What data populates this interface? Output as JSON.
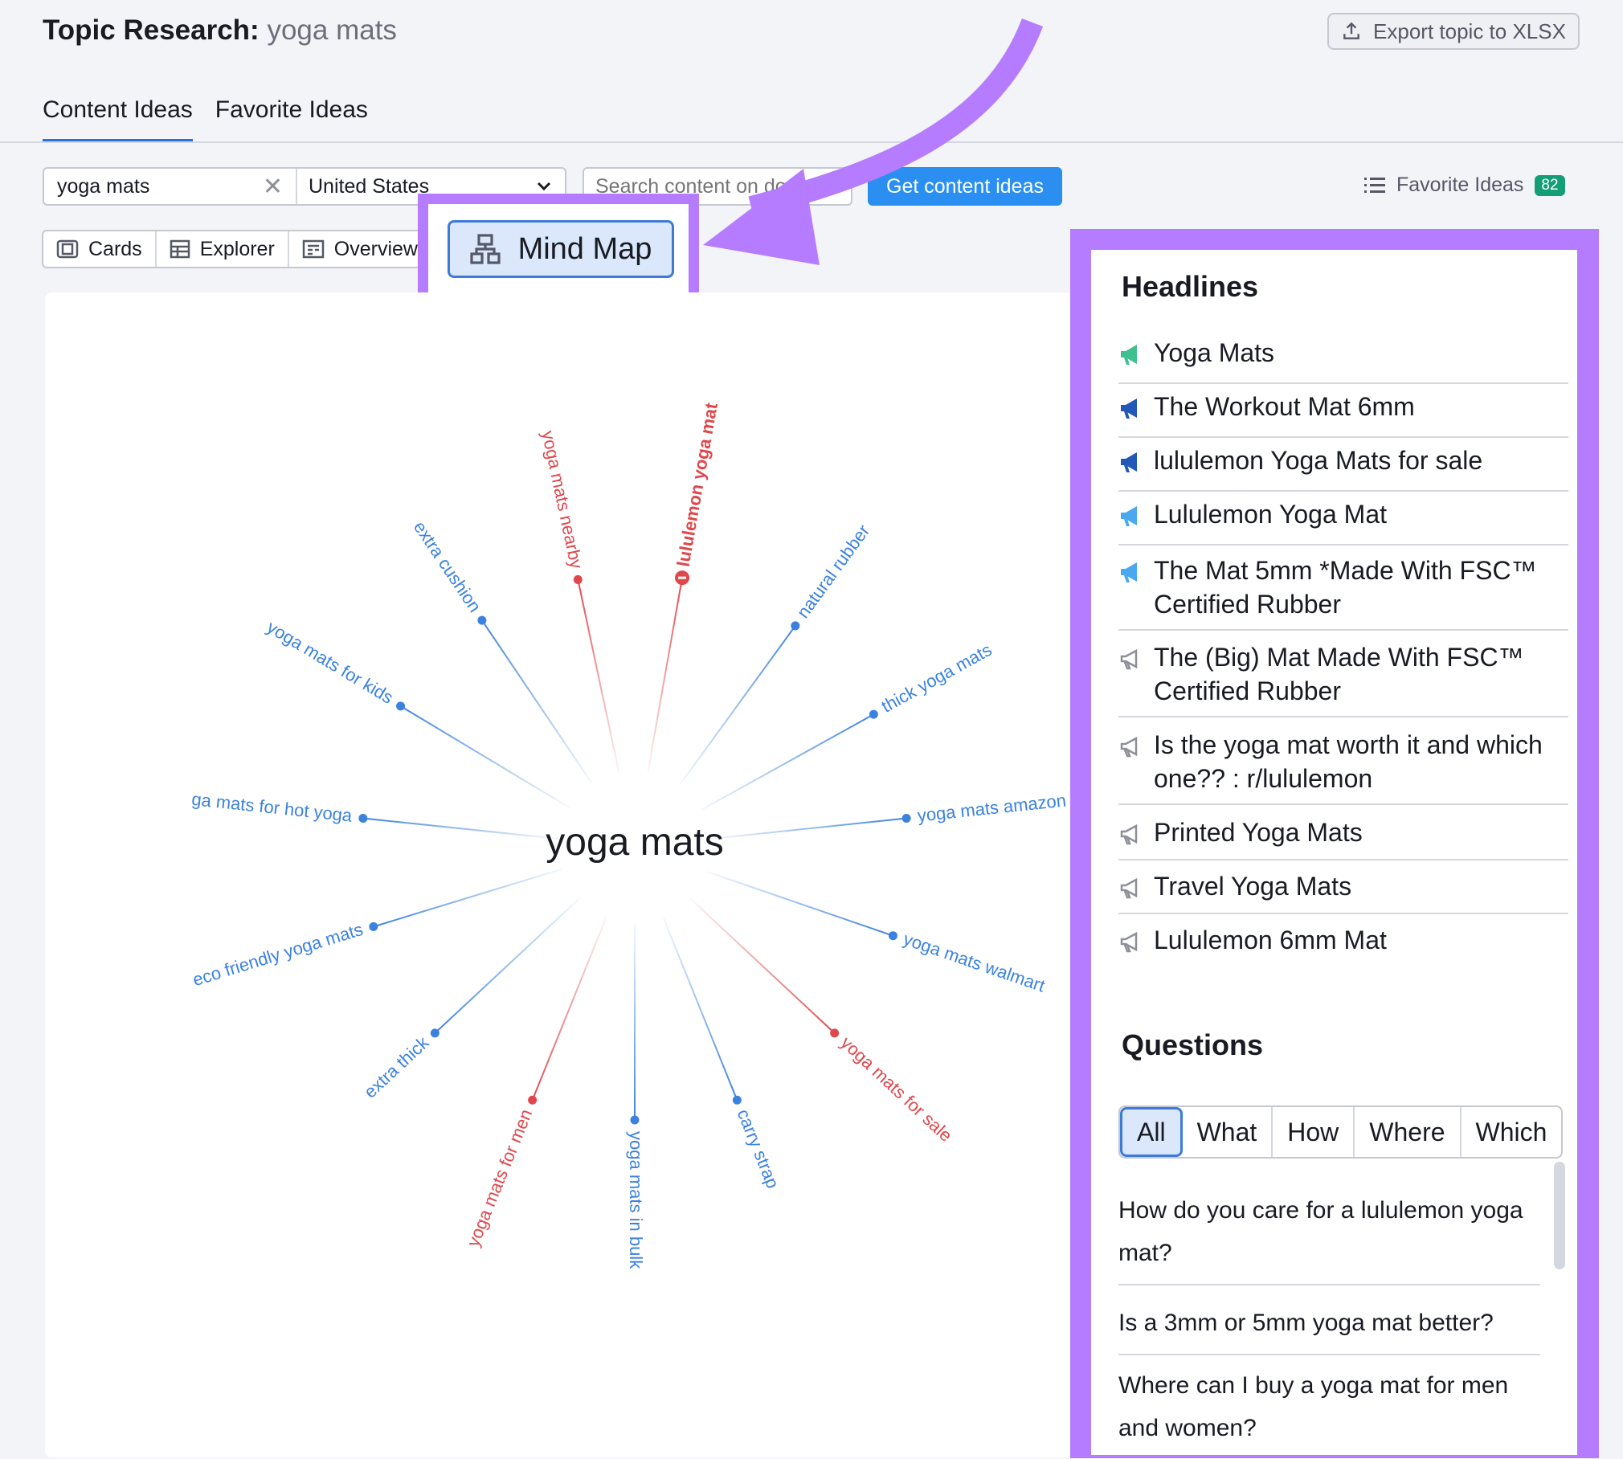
{
  "header": {
    "title_label": "Topic Research:",
    "keyword": "yoga mats",
    "export_label": "Export topic to XLSX"
  },
  "tabs": [
    {
      "label": "Content Ideas",
      "active": true
    },
    {
      "label": "Favorite Ideas",
      "active": false
    }
  ],
  "search": {
    "query": "yoga mats",
    "country": "United States",
    "domain_placeholder": "Search content on domain",
    "submit_label": "Get content ideas"
  },
  "favorites": {
    "label": "Favorite Ideas",
    "count": "82"
  },
  "views": [
    {
      "label": "Cards",
      "icon": "cards-icon"
    },
    {
      "label": "Explorer",
      "icon": "table-icon"
    },
    {
      "label": "Overview",
      "icon": "overview-icon"
    },
    {
      "label": "Mind Map",
      "icon": "mindmap-icon",
      "active": true
    }
  ],
  "mindmap": {
    "center": "yoga mats",
    "nodes": [
      {
        "label": "yoga mats nearby",
        "color": "#e0474c",
        "angle": -102
      },
      {
        "label": "lululemon yoga mat",
        "color": "#e0474c",
        "angle": -80,
        "selected": true
      },
      {
        "label": "natural rubber",
        "color": "#3b82e0",
        "angle": -54
      },
      {
        "label": "thick yoga mats",
        "color": "#3b82e0",
        "angle": -29
      },
      {
        "label": "yoga mats amazon",
        "color": "#3b82e0",
        "angle": -6
      },
      {
        "label": "yoga mats walmart",
        "color": "#3b82e0",
        "angle": 19
      },
      {
        "label": "yoga mats for sale",
        "color": "#e0474c",
        "angle": 43
      },
      {
        "label": "carry strap",
        "color": "#3b82e0",
        "angle": 68
      },
      {
        "label": "yoga mats in bulk",
        "color": "#3b82e0",
        "angle": 90
      },
      {
        "label": "yoga mats for men",
        "color": "#e0474c",
        "angle": 112
      },
      {
        "label": "extra thick",
        "color": "#3b82e0",
        "angle": 137
      },
      {
        "label": "eco friendly yoga mats",
        "color": "#3b82e0",
        "angle": 163
      },
      {
        "label": "ga mats for hot yoga",
        "color": "#3b82e0",
        "angle": 186
      },
      {
        "label": "yoga mats for kids",
        "color": "#3b82e0",
        "angle": 211
      },
      {
        "label": "extra cushion",
        "color": "#3b82e0",
        "angle": 236
      }
    ]
  },
  "headlines": {
    "title": "Headlines",
    "items": [
      {
        "text": "Yoga Mats",
        "icon_color": "#3fc08f"
      },
      {
        "text": "The Workout Mat 6mm",
        "icon_color": "#2458b8"
      },
      {
        "text": "lululemon Yoga Mats for sale",
        "icon_color": "#2458b8"
      },
      {
        "text": "Lululemon Yoga Mat",
        "icon_color": "#4aa8f0"
      },
      {
        "text": "The Mat 5mm *Made With FSC™ Certified Rubber",
        "icon_color": "#4aa8f0"
      },
      {
        "text": "The (Big) Mat Made With FSC™ Certified Rubber",
        "icon_color": "#8e9099"
      },
      {
        "text": "Is the yoga mat worth it and which one?? : r/lululemon",
        "icon_color": "#8e9099"
      },
      {
        "text": "Printed Yoga Mats",
        "icon_color": "#8e9099"
      },
      {
        "text": "Travel Yoga Mats",
        "icon_color": "#8e9099"
      },
      {
        "text": "Lululemon 6mm Mat",
        "icon_color": "#8e9099"
      }
    ]
  },
  "questions": {
    "title": "Questions",
    "filters": [
      "All",
      "What",
      "How",
      "Where",
      "Which"
    ],
    "items": [
      "How do you care for a lululemon yoga mat?",
      "Is a 3mm or 5mm yoga mat better?",
      "Where can I buy a yoga mat for men and women?"
    ]
  }
}
